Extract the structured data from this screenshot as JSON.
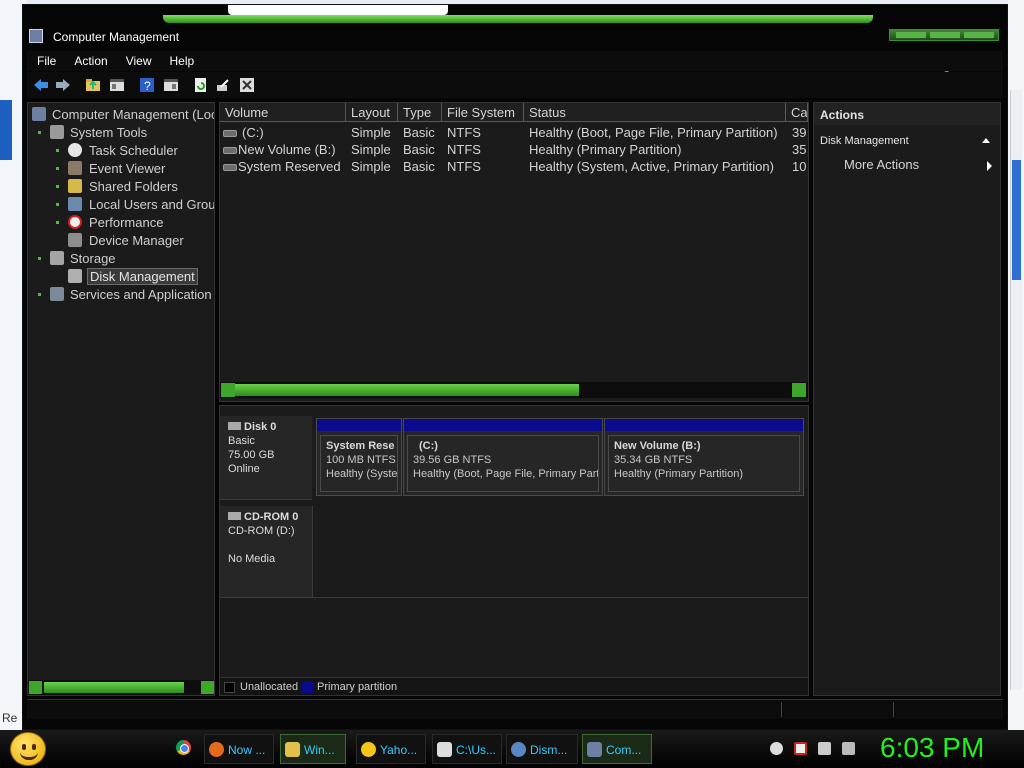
{
  "window": {
    "title": "Computer Management",
    "menu": [
      "File",
      "Action",
      "View",
      "Help"
    ]
  },
  "toolbar_icons": [
    "back-arrow-icon",
    "forward-arrow-icon",
    "folder-up-icon",
    "show-hide-tree-icon",
    "help-icon",
    "properties-icon",
    "refresh-icon",
    "export-icon",
    "settings-icon"
  ],
  "tree": {
    "root": "Computer Management (Loc",
    "items": [
      {
        "label": "System Tools",
        "icon": "tools-icon"
      },
      {
        "label": "Task Scheduler",
        "icon": "clock-icon"
      },
      {
        "label": "Event Viewer",
        "icon": "event-viewer-icon"
      },
      {
        "label": "Shared Folders",
        "icon": "shared-folder-icon"
      },
      {
        "label": "Local Users and Grou",
        "icon": "users-icon"
      },
      {
        "label": "Performance",
        "icon": "performance-icon"
      },
      {
        "label": "Device Manager",
        "icon": "device-manager-icon"
      },
      {
        "label": "Storage",
        "icon": "storage-icon"
      },
      {
        "label": "Disk Management",
        "icon": "disk-icon"
      },
      {
        "label": "Services and Application",
        "icon": "services-icon"
      }
    ]
  },
  "volumes": {
    "headers": [
      "Volume",
      "Layout",
      "Type",
      "File System",
      "Status",
      "Ca"
    ],
    "rows": [
      [
        "(C:)",
        "Simple",
        "Basic",
        "NTFS",
        "Healthy (Boot, Page File, Primary Partition)",
        "39"
      ],
      [
        "New Volume (B:)",
        "Simple",
        "Basic",
        "NTFS",
        "Healthy (Primary Partition)",
        "35"
      ],
      [
        "System Reserved",
        "Simple",
        "Basic",
        "NTFS",
        "Healthy (System, Active, Primary Partition)",
        "10"
      ]
    ]
  },
  "disks": [
    {
      "name": "Disk 0",
      "type": "Basic",
      "size": "75.00 GB",
      "state": "Online",
      "partitions": [
        {
          "name": "System Rese",
          "size": "100 MB NTFS",
          "status": "Healthy (Syste"
        },
        {
          "name": "(C:)",
          "size": "39.56 GB NTFS",
          "status": "Healthy (Boot, Page File, Primary Partiti"
        },
        {
          "name": "New Volume  (B:)",
          "size": "35.34 GB NTFS",
          "status": "Healthy (Primary Partition)"
        }
      ]
    },
    {
      "name": "CD-ROM 0",
      "type": "CD-ROM (D:)",
      "state": "No Media"
    }
  ],
  "legend": {
    "unallocated": "Unallocated",
    "primary": "Primary partition"
  },
  "colors": {
    "accent_green": "#3da62b",
    "primary_partition": "#0a0a8e",
    "clock": "#22ee22",
    "taskbar_text": "#39c9ff"
  },
  "actions": {
    "title": "Actions",
    "section": "Disk Management",
    "more": "More Actions"
  },
  "taskbar": {
    "buttons": [
      "Now ...",
      "Win...",
      "Yaho...",
      "C:\\Us...",
      "Dism...",
      "Com..."
    ],
    "clock": "6:03 PM"
  },
  "desktop": {
    "left_label": "Re"
  }
}
